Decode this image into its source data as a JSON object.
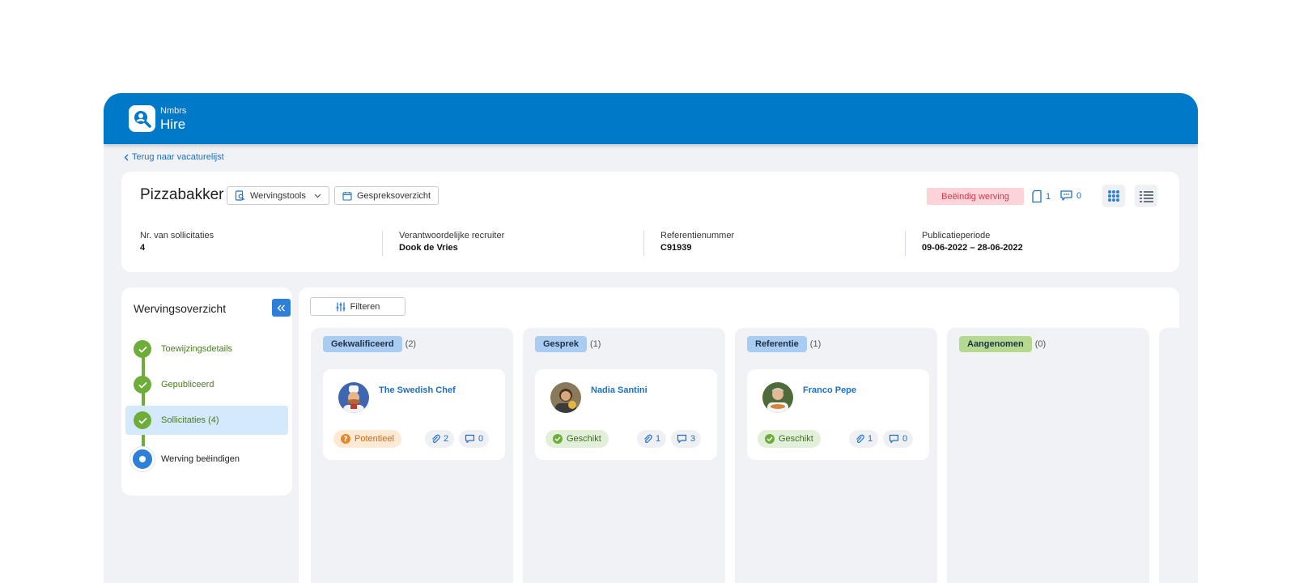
{
  "app": {
    "brand_small": "Nmbrs",
    "brand_big": "Hire"
  },
  "nav": {
    "back_label": "Terug naar vacaturelijst"
  },
  "job": {
    "title": "Pizzabakker",
    "tools_label": "Wervingstools",
    "interviews_label": "Gespreksoverzicht",
    "end_label": "Beëindig werving",
    "doc_count": "1",
    "comment_count": "0"
  },
  "meta": [
    {
      "label": "Nr. van sollicitaties",
      "value": "4"
    },
    {
      "label": "Verantwoordelijke recruiter",
      "value": "Dook de Vries"
    },
    {
      "label": "Referentienummer",
      "value": "C91939"
    },
    {
      "label": "Publicatieperiode",
      "value": "09-06-2022 – 28-06-2022"
    }
  ],
  "sidebar": {
    "title": "Wervingsoverzicht",
    "steps": [
      {
        "label": "Toewijzingsdetails"
      },
      {
        "label": "Gepubliceerd"
      },
      {
        "label": "Sollicitaties (4)"
      },
      {
        "label": "Werving beëindigen"
      }
    ]
  },
  "board": {
    "filter_label": "Filteren",
    "columns": [
      {
        "name": "Gekwalificeerd",
        "count": "(2)",
        "color": "#a9cdf2",
        "card": {
          "name": "The Swedish Chef",
          "status": "Potentieel",
          "attachments": "2",
          "comments": "0"
        }
      },
      {
        "name": "Gesprek",
        "count": "(1)",
        "color": "#a9cdf2",
        "card": {
          "name": "Nadia Santini",
          "status": "Geschikt",
          "attachments": "1",
          "comments": "3"
        }
      },
      {
        "name": "Referentie",
        "count": "(1)",
        "color": "#a9cdf2",
        "card": {
          "name": "Franco Pepe",
          "status": "Geschikt",
          "attachments": "1",
          "comments": "0"
        }
      },
      {
        "name": "Aangenomen",
        "count": "(0)",
        "color": "#b5d98f"
      }
    ]
  },
  "colors": {
    "primary": "#0079c9",
    "accent": "#2d7fd8",
    "success": "#6fad3b",
    "danger": "#d13a4b"
  }
}
